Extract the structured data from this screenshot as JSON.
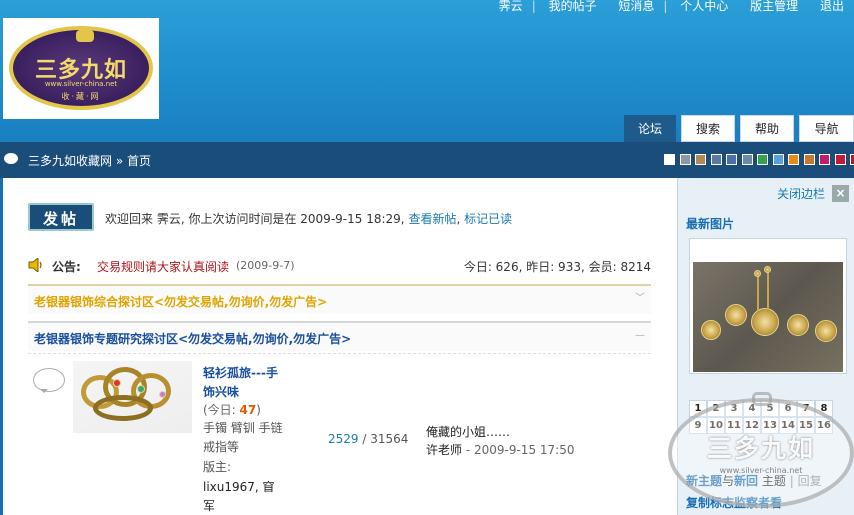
{
  "top_links": [
    "霁云",
    "我的帖子",
    "短消息",
    "个人中心",
    "版主管理",
    "退出"
  ],
  "logo": {
    "title": "三多九如",
    "url": "www.silver-china.net",
    "subtitle": "收·藏·网"
  },
  "nav_tabs": [
    "论坛",
    "搜索",
    "帮助",
    "导航"
  ],
  "breadcrumb": "三多九如收藏网 » 首页",
  "theme_swatches": [
    "#ffffff",
    "#8a98a8",
    "#b08a52",
    "#5a7b9c",
    "#4a6fae",
    "#6c8aa8",
    "#34a34a",
    "#5aa0d8",
    "#e88a1a",
    "#c77a2a",
    "#c21c6c",
    "#c21c3a",
    "#b01a1a",
    "#8a4aa8"
  ],
  "post_button": "发帖",
  "welcome": {
    "text": "欢迎回来 霁云, 你上次访问时间是在",
    "time": "2009-9-15 18:29,",
    "link_new": "查看新帖",
    "comma": ", ",
    "link_mark": "标记已读"
  },
  "notice": {
    "label": "公告:",
    "title": "交易规则请大家认真阅读",
    "date": "(2009-9-7)",
    "stats": "今日: 626, 昨日: 933, 会员: 8214"
  },
  "sections": [
    {
      "title": "老银器银饰综合探讨区<勿发交易帖,勿询价,勿发广告>"
    },
    {
      "title": "老银器银饰专题研究探讨区<勿发交易帖,勿询价,勿发广告>"
    }
  ],
  "forum": {
    "name": "轻衫孤旅---手饰兴味",
    "today_prefix": "(今日: ",
    "today_count": "47",
    "today_suffix": ")",
    "description": "手镯 臂钏 手链 戒指等",
    "moderator_label": "版主:",
    "moderators": "lixu1967, 窅军",
    "topics": "2529",
    "slash": " / ",
    "posts": "31564",
    "last_post_title": "俺藏的小姐……",
    "last_post_author": "许老师",
    "last_post_time": " - 2009-9-15 17:50"
  },
  "sidebar": {
    "close_label": "关闭边栏",
    "close_x": "×",
    "latest_pics_title": "最新图片",
    "pager": [
      "1",
      "2",
      "3",
      "4",
      "5",
      "6",
      "7",
      "8",
      "9",
      "10",
      "11",
      "12",
      "13",
      "14",
      "15",
      "16"
    ],
    "tabs_a": "新主题",
    "tabs_and": "与",
    "tabs_b": "新回",
    "tabs_c": " 主题",
    "tabs_sep": "|",
    "tabs_d": "回复",
    "last_line": "复制标志监察者看"
  },
  "watermark": {
    "title": "三多九如",
    "url": "www.silver-china.net"
  }
}
